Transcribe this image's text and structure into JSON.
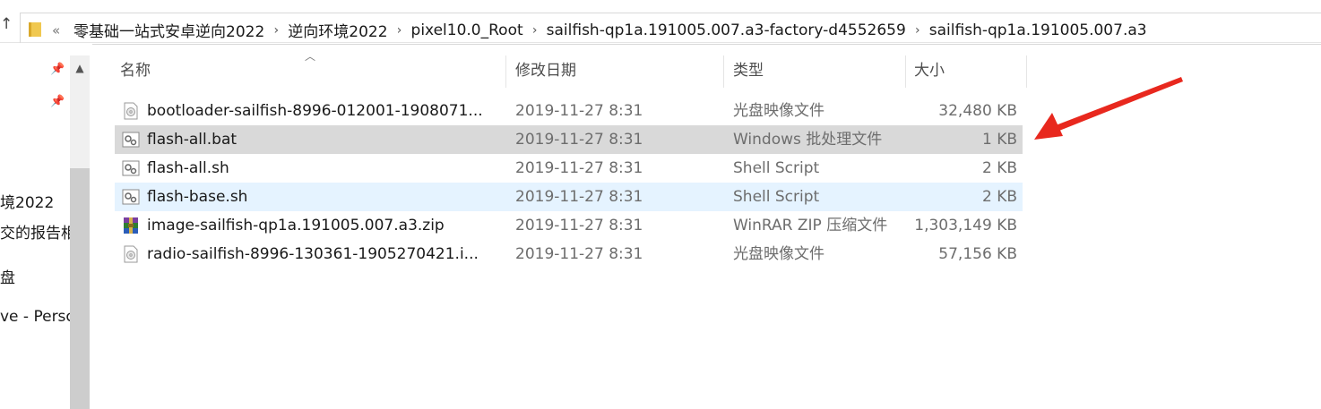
{
  "nav": {
    "up_arrow": "↑",
    "overflow_chevron": "«",
    "breadcrumbs": [
      "零基础一站式安卓逆向2022",
      "逆向环境2022",
      "pixel10.0_Root",
      "sailfish-qp1a.191005.007.a3-factory-d4552659",
      "sailfish-qp1a.191005.007.a3"
    ],
    "separator": "›"
  },
  "sidebar": {
    "items": [
      {
        "label": "境2022"
      },
      {
        "label": "交的报告相"
      },
      {
        "label": "盘"
      },
      {
        "label": "ve - Persc"
      }
    ]
  },
  "columns": {
    "name": "名称",
    "date": "修改日期",
    "type": "类型",
    "size": "大小"
  },
  "files": [
    {
      "name": "bootloader-sailfish-8996-012001-1908071...",
      "date": "2019-11-27 8:31",
      "type": "光盘映像文件",
      "size": "32,480 KB",
      "icon": "disc-image-icon"
    },
    {
      "name": "flash-all.bat",
      "date": "2019-11-27 8:31",
      "type": "Windows 批处理文件",
      "size": "1 KB",
      "icon": "batch-file-icon"
    },
    {
      "name": "flash-all.sh",
      "date": "2019-11-27 8:31",
      "type": "Shell Script",
      "size": "2 KB",
      "icon": "script-file-icon"
    },
    {
      "name": "flash-base.sh",
      "date": "2019-11-27 8:31",
      "type": "Shell Script",
      "size": "2 KB",
      "icon": "script-file-icon"
    },
    {
      "name": "image-sailfish-qp1a.191005.007.a3.zip",
      "date": "2019-11-27 8:31",
      "type": "WinRAR ZIP 压缩文件",
      "size": "1,303,149 KB",
      "icon": "winrar-archive-icon"
    },
    {
      "name": "radio-sailfish-8996-130361-1905270421.i...",
      "date": "2019-11-27 8:31",
      "type": "光盘映像文件",
      "size": "57,156 KB",
      "icon": "disc-image-icon"
    }
  ],
  "colors": {
    "selected_row": "#d9d9d9",
    "hover_row": "#e5f3ff",
    "annotation_arrow": "#e8281e",
    "folder": "#f0c850"
  }
}
